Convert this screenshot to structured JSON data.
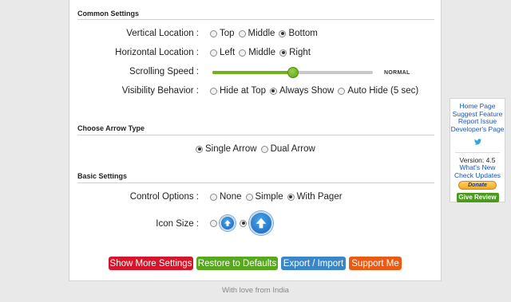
{
  "sections": {
    "common": "Common Settings",
    "arrow": "Choose Arrow Type",
    "basic": "Basic Settings"
  },
  "vertical": {
    "label": "Vertical Location :",
    "options": [
      "Top",
      "Middle",
      "Bottom"
    ],
    "selected": "Bottom"
  },
  "horizontal": {
    "label": "Horizontal Location :",
    "options": [
      "Left",
      "Middle",
      "Right"
    ],
    "selected": "Right"
  },
  "speed": {
    "label": "Scrolling Speed :",
    "value_text": "NORMAL",
    "level": 0.5
  },
  "visibility": {
    "label": "Visibility Behavior :",
    "options": [
      "Hide at Top",
      "Always Show",
      "Auto Hide (5 sec)"
    ],
    "selected": "Always Show"
  },
  "arrow_type": {
    "options": [
      "Single Arrow",
      "Dual Arrow"
    ],
    "selected": "Single Arrow"
  },
  "control": {
    "label": "Control Options :",
    "options": [
      "None",
      "Simple",
      "With Pager"
    ],
    "selected": "With Pager"
  },
  "icon_size": {
    "label": "Icon Size :",
    "selected": "large"
  },
  "buttons": {
    "more": "Show More Settings",
    "restore": "Restore to Defaults",
    "export": "Export / Import",
    "support": "Support Me"
  },
  "colors": {
    "more": "#d5162a",
    "restore": "#57a81f",
    "export": "#3a86c7",
    "support": "#ea5a12"
  },
  "footer": "With love from India",
  "sidebar": {
    "links": [
      "Home Page",
      "Suggest Feature",
      "Report Issue",
      "Developer's Page"
    ],
    "twitter_icon": "twitter-bird-icon",
    "version": "Version: 4.5",
    "whats_new": "What's New",
    "check_updates": "Check Updates",
    "donate": "Donate",
    "review": "Give Review"
  }
}
